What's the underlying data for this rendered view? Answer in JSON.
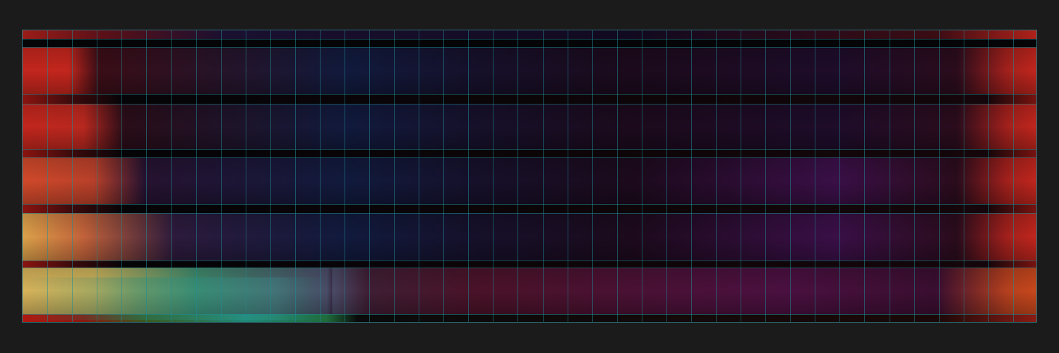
{
  "colors": {
    "page_background": "#1b1b1b",
    "grid_line": "#1f8d95",
    "base_dark": "#07060c",
    "edge_red": "#c2261d",
    "edge_orange": "#d95d2a",
    "edge_gold": "#d8b35a",
    "mid_navy": "#111a3d",
    "mid_purple": "#3a0f47",
    "mid_magenta": "#4a1040",
    "accent_teal": "#1f8a78",
    "separator_black": "#050407"
  },
  "grid": {
    "columns": 41,
    "bands": 5
  }
}
